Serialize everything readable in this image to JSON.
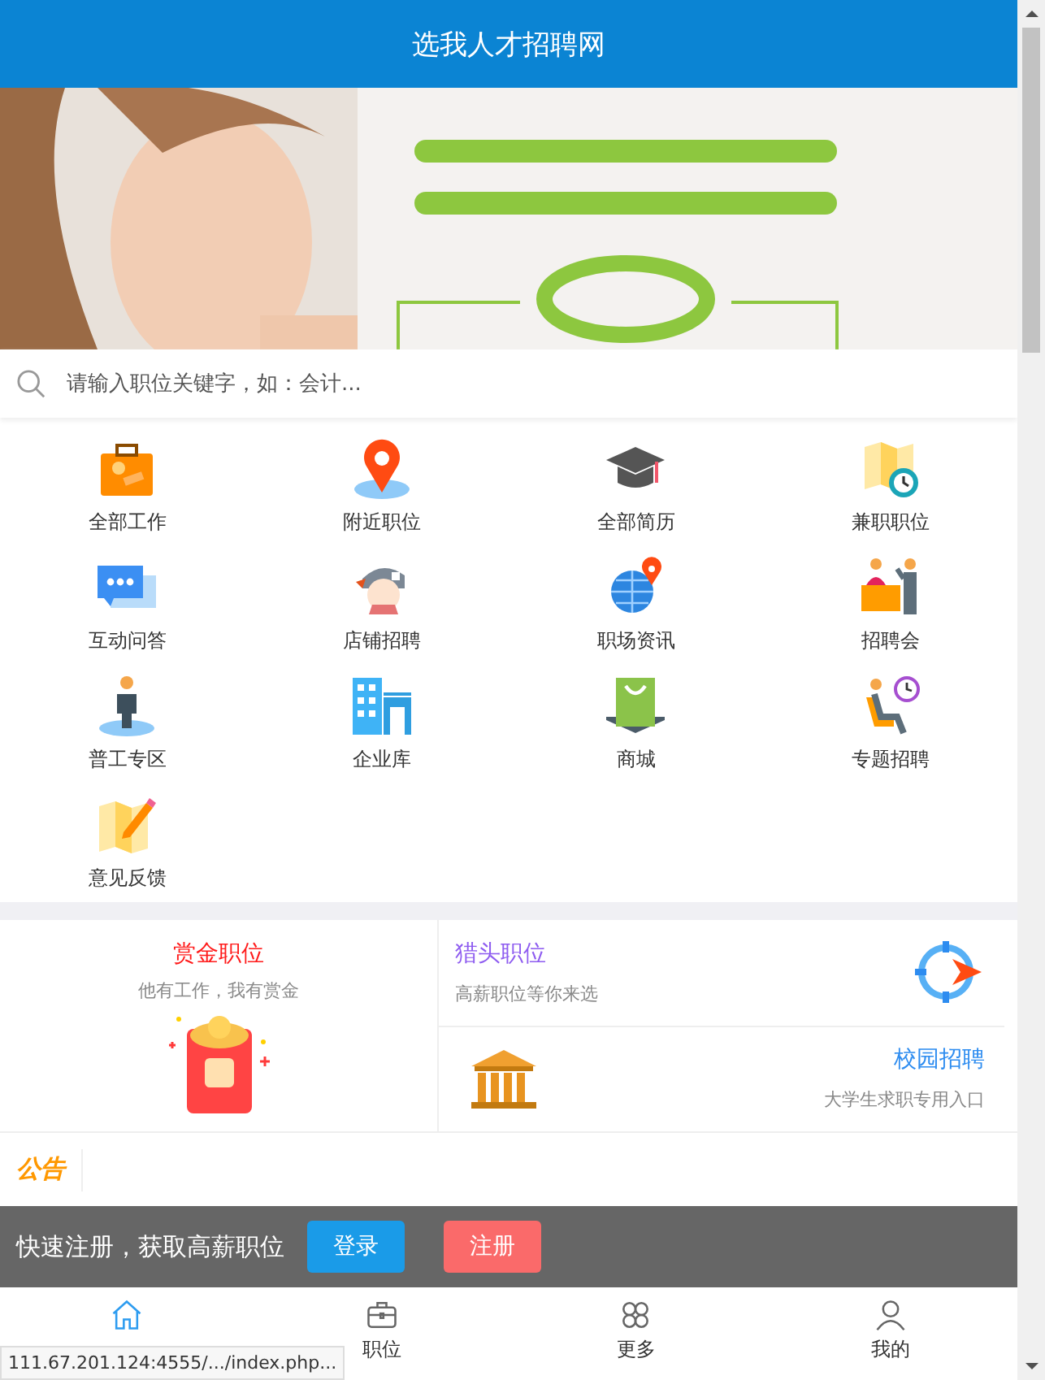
{
  "header": {
    "title": "选我人才招聘网"
  },
  "search": {
    "placeholder": "请输入职位关键字，如：会计..."
  },
  "menu": [
    {
      "label": "全部工作"
    },
    {
      "label": "附近职位"
    },
    {
      "label": "全部简历"
    },
    {
      "label": "兼职职位"
    },
    {
      "label": "互动问答"
    },
    {
      "label": "店铺招聘"
    },
    {
      "label": "职场资讯"
    },
    {
      "label": "招聘会"
    },
    {
      "label": "普工专区"
    },
    {
      "label": "企业库"
    },
    {
      "label": "商城"
    },
    {
      "label": "专题招聘"
    },
    {
      "label": "意见反馈"
    }
  ],
  "features": [
    {
      "title": "赏金职位",
      "subtitle": "他有工作，我有赏金",
      "color": "#ff1a1a"
    },
    {
      "title": "猎头职位",
      "subtitle": "高薪职位等你来选",
      "color": "#8e5cf0"
    },
    {
      "title": "校园招聘",
      "subtitle": "大学生求职专用入口",
      "color": "#2d8cf0"
    }
  ],
  "notice": {
    "label": "公告"
  },
  "register_bar": {
    "text": "快速注册，获取高薪职位",
    "buttons": [
      {
        "label": "登录",
        "kind": "login"
      },
      {
        "label": "注册",
        "kind": "register"
      }
    ]
  },
  "bottom_nav": [
    {
      "selected": true
    },
    {
      "label": "职位",
      "selected": false
    },
    {
      "label": "更多",
      "selected": false
    },
    {
      "label": "我的",
      "selected": false
    }
  ],
  "status_url": "111.67.201.124:4555/.../index.php..."
}
